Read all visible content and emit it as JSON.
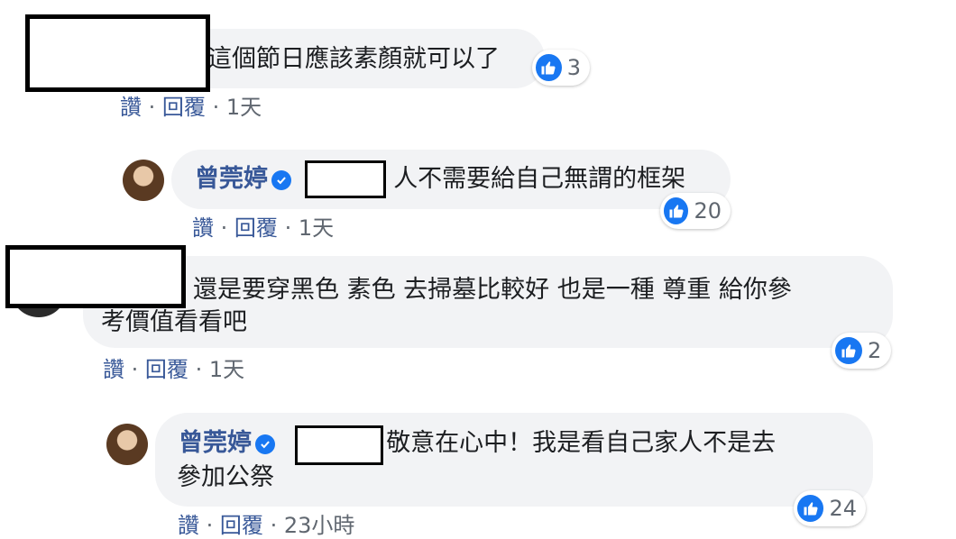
{
  "comments": [
    {
      "text": "這個節日應該素顏就可以了",
      "reactions": "3",
      "actions": {
        "like": "讚",
        "reply": "回覆",
        "dot": "·",
        "time": "1天"
      }
    },
    {
      "author": "曾莞婷",
      "text": "人不需要給自己無謂的框架",
      "reactions": "20",
      "actions": {
        "like": "讚",
        "reply": "回覆",
        "dot": "·",
        "time": "1天"
      }
    },
    {
      "text_line1": "還是要穿黑色 素色 去掃墓比較好 也是一種 尊重 給你參",
      "text_line2": "考價值看看吧",
      "reactions": "2",
      "actions": {
        "like": "讚",
        "reply": "回覆",
        "dot": "·",
        "time": "1天"
      }
    },
    {
      "author": "曾莞婷",
      "text_line1": "敬意在心中！我是看自己家人不是去",
      "text_line2": "參加公祭",
      "reactions": "24",
      "actions": {
        "like": "讚",
        "reply": "回覆",
        "dot": "·",
        "time": "23小時"
      }
    }
  ],
  "icons": {
    "like": "thumbs-up-icon",
    "verified": "verified-check-icon"
  },
  "colors": {
    "link": "#385898",
    "bubble": "#f2f3f5",
    "like_blue": "#1877f2"
  }
}
